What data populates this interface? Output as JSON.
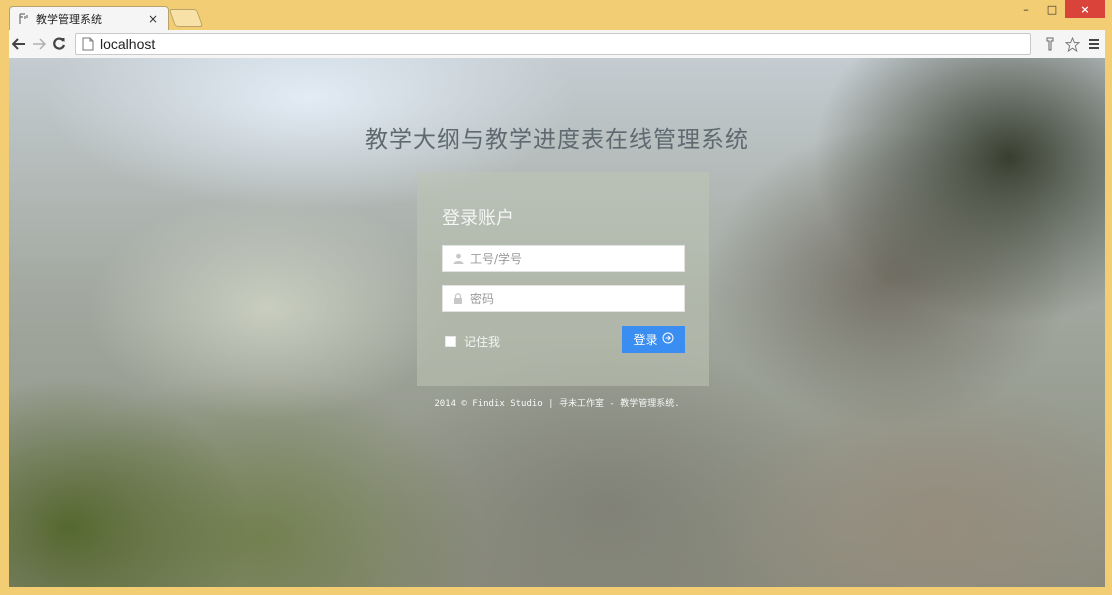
{
  "browser": {
    "tab_title": "教学管理系统",
    "tab_close": "×",
    "url": "localhost",
    "window_controls": {
      "minimize": "–",
      "maximize": "□",
      "close": "×"
    }
  },
  "page": {
    "system_title": "教学大纲与教学进度表在线管理系统",
    "login": {
      "heading": "登录账户",
      "username_placeholder": "工号/学号",
      "password_placeholder": "密码",
      "remember_label": "记住我",
      "submit_label": "登录"
    },
    "footer": "2014 © Findix Studio | 寻未工作室 - 教学管理系统."
  },
  "colors": {
    "frame": "#f2cd73",
    "login_button": "#3a8ef1",
    "close_button": "#d9433a"
  }
}
